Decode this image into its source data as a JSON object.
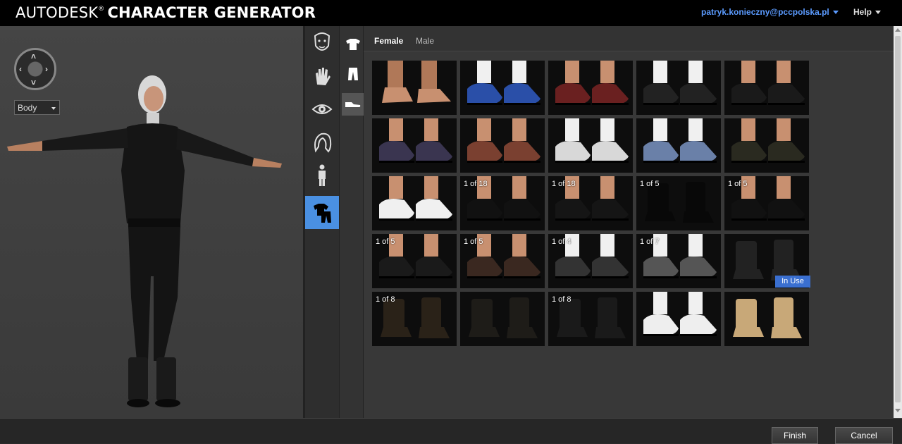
{
  "app": {
    "brand_main": "AUTODESK",
    "brand_reg": "®",
    "brand_sub": "CHARACTER GENERATOR",
    "user": "patryk.konieczny@pccpolska.pl",
    "help": "Help"
  },
  "viewport": {
    "body_select": "Body"
  },
  "side_tabs": [
    {
      "icon": "face-icon"
    },
    {
      "icon": "skin-icon"
    },
    {
      "icon": "eye-icon"
    },
    {
      "icon": "hair-icon"
    },
    {
      "icon": "body-icon"
    },
    {
      "icon": "clothing-icon",
      "active": true
    }
  ],
  "sub_tabs": [
    {
      "icon": "top-icon"
    },
    {
      "icon": "pants-icon"
    },
    {
      "icon": "shoes-icon",
      "active": true
    }
  ],
  "gender_tabs": {
    "female": "Female",
    "male": "Male"
  },
  "shoes": [
    {
      "count": "",
      "style": "bare",
      "color": "#c89070"
    },
    {
      "count": "",
      "style": "sneaker",
      "color": "#2a4fa8"
    },
    {
      "count": "",
      "style": "dress",
      "color": "#6a2020"
    },
    {
      "count": "",
      "style": "sneaker",
      "color": "#222222"
    },
    {
      "count": "",
      "style": "dress",
      "color": "#1a1a1a"
    },
    {
      "count": "",
      "style": "dress",
      "color": "#3a3550"
    },
    {
      "count": "",
      "style": "dress",
      "color": "#7a4030"
    },
    {
      "count": "",
      "style": "sneaker",
      "color": "#d8d8d8"
    },
    {
      "count": "",
      "style": "sneaker",
      "color": "#6a80a8"
    },
    {
      "count": "",
      "style": "dress",
      "color": "#2a2a20"
    },
    {
      "count": "",
      "style": "dress",
      "color": "#f0f0f0"
    },
    {
      "count": "1 of 18",
      "style": "flat",
      "color": "#111111"
    },
    {
      "count": "1 of 18",
      "style": "flat",
      "color": "#151515"
    },
    {
      "count": "1 of 5",
      "style": "boot",
      "color": "#080808"
    },
    {
      "count": "1 of 5",
      "style": "flat",
      "color": "#111111"
    },
    {
      "count": "1 of 5",
      "style": "flat",
      "color": "#1a1a1a"
    },
    {
      "count": "1 of 5",
      "style": "flat",
      "color": "#3a2820"
    },
    {
      "count": "1 of 4",
      "style": "sneaker",
      "color": "#333333"
    },
    {
      "count": "1 of 7",
      "style": "sneaker",
      "color": "#555555"
    },
    {
      "count": "",
      "style": "boot",
      "color": "#222222"
    },
    {
      "count": "1 of 8",
      "style": "boot",
      "color": "#2a2218"
    },
    {
      "count": "",
      "style": "boot",
      "color": "#1e1c18"
    },
    {
      "count": "1 of 8",
      "style": "boot",
      "color": "#1a1a1a"
    },
    {
      "count": "",
      "style": "sneaker",
      "color": "#eeeeee"
    },
    {
      "count": "",
      "style": "boot",
      "color": "#c8a878"
    }
  ],
  "in_use_label": "In Use",
  "footer": {
    "finish": "Finish",
    "cancel": "Cancel"
  }
}
